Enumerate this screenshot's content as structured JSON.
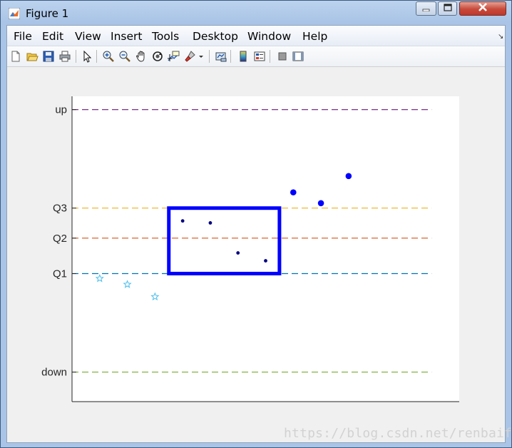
{
  "window": {
    "title": "Figure 1",
    "controls": {
      "minimize": "minimize-icon",
      "maximize": "maximize-icon",
      "close": "close-icon"
    }
  },
  "menubar": {
    "items": [
      "File",
      "Edit",
      "View",
      "Insert",
      "Tools",
      "Desktop",
      "Window",
      "Help"
    ]
  },
  "toolbar": {
    "icons": [
      "new-figure-icon",
      "open-file-icon",
      "save-icon",
      "print-icon",
      "pointer-icon",
      "zoom-in-icon",
      "zoom-out-icon",
      "pan-icon",
      "rotate-3d-icon",
      "data-cursor-icon",
      "brush-icon",
      "link-plot-icon",
      "colorbar-icon",
      "legend-icon",
      "hide-plot-tools-icon",
      "show-plot-tools-icon"
    ]
  },
  "colors": {
    "axes_bg": "#ffffff",
    "figure_bg": "#f0f0f0",
    "box": "#0000ff",
    "up_line": "#7e2f8e",
    "q3_line": "#edb120",
    "q2_line": "#d95319",
    "q1_line": "#0072bd",
    "down_line": "#77ac30",
    "star": "#4dbeee",
    "inner_dot": "#000080",
    "outer_dot": "#0000ff"
  },
  "chart_data": {
    "type": "scatter",
    "title": "",
    "xlabel": "",
    "ylabel": "",
    "xlim": [
      0,
      14
    ],
    "ylim": [
      -0.6,
      5.6
    ],
    "grid": false,
    "legend": "none",
    "yticks": [
      {
        "value": 0,
        "label": "down"
      },
      {
        "value": 2,
        "label": "Q1"
      },
      {
        "value": 2.72,
        "label": "Q2"
      },
      {
        "value": 3.33,
        "label": "Q3"
      },
      {
        "value": 5.33,
        "label": "up"
      }
    ],
    "reference_lines": [
      {
        "y": 5.33,
        "x_range": [
          0,
          13
        ],
        "style": "dashed",
        "color": "#7e2f8e"
      },
      {
        "y": 3.33,
        "x_range": [
          0,
          13
        ],
        "style": "dashed",
        "color": "#edb120"
      },
      {
        "y": 2.72,
        "x_range": [
          0,
          13
        ],
        "style": "dashed",
        "color": "#d95319"
      },
      {
        "y": 2.0,
        "x_range": [
          0,
          13
        ],
        "style": "dashed",
        "color": "#0072bd"
      },
      {
        "y": 0.0,
        "x_range": [
          0,
          13
        ],
        "style": "dashed",
        "color": "#77ac30"
      }
    ],
    "box": {
      "x0": 3.5,
      "x1": 7.5,
      "y0": 2.0,
      "y1": 3.33,
      "color": "#0000ff"
    },
    "series": [
      {
        "marker": "star",
        "color": "#4dbeee",
        "x": [
          1,
          2,
          3
        ],
        "y": [
          1.9,
          1.78,
          1.53
        ]
      },
      {
        "marker": "dot-small",
        "color": "#000080",
        "x": [
          4,
          5,
          6,
          7
        ],
        "y": [
          3.07,
          3.03,
          2.42,
          2.26
        ]
      },
      {
        "marker": "dot-large",
        "color": "#0000ff",
        "x": [
          8,
          9,
          10
        ],
        "y": [
          3.65,
          3.43,
          3.98
        ]
      }
    ]
  },
  "watermark": "https://blog.csdn.net/renbaifen"
}
